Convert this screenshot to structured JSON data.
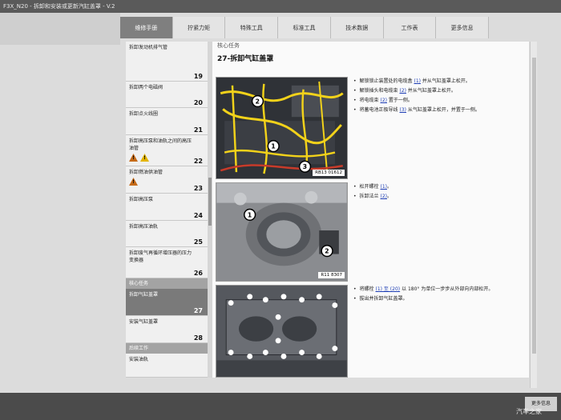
{
  "window": {
    "title": "F3X_N20 - 拆卸和安装或更新汽缸盖罩 - V.2"
  },
  "tabs": [
    {
      "label": "维修手册",
      "active": true
    },
    {
      "label": "拧紧力矩"
    },
    {
      "label": "特殊工具"
    },
    {
      "label": "标准工具"
    },
    {
      "label": "技术数据"
    },
    {
      "label": "工作表"
    },
    {
      "label": "更多信息"
    }
  ],
  "sidebar": {
    "items": [
      {
        "label": "拆卸发动机排气管",
        "num": "19"
      },
      {
        "label": "拆卸两个电磁阀",
        "num": "20"
      },
      {
        "label": "拆卸点火线圈",
        "num": "21"
      },
      {
        "label": "拆卸高压泵和油轨之间的高压油管",
        "num": "22"
      },
      {
        "label": "拆卸燃油供油管",
        "num": "23"
      },
      {
        "label": "拆卸高压泵",
        "num": "24"
      },
      {
        "label": "拆卸高压油轨",
        "num": "25"
      },
      {
        "label": "拆卸废气再循环增压器的压力变换器",
        "num": "26"
      }
    ],
    "core_header": "核心任务",
    "core_items": [
      {
        "label": "拆卸气缸盖罩",
        "num": "27"
      },
      {
        "label": "安装气缸盖罩",
        "num": "28"
      }
    ],
    "followup_header": "后续工作",
    "followup_items": [
      {
        "label": "安装油轨"
      }
    ]
  },
  "content": {
    "cut_heading": "核心任务",
    "title": "27-拆卸气缸盖罩",
    "sections": [
      {
        "image_ref": "RB13 01612",
        "steps": [
          {
            "pre": "解锁锁止装置处的电缆盒",
            "ref": "(1)",
            "post": "并从气缸盖罩上松开。"
          },
          {
            "pre": "解锁插头和电缆束",
            "ref": "(2)",
            "post": "并从气缸盖罩上松开。"
          },
          {
            "pre": "将电缆束",
            "ref": "(2)",
            "post": "置于一侧。"
          },
          {
            "pre": "将蓄电池正极导线",
            "ref": "(3)",
            "post": "从气缸盖罩上松开，并置于一侧。"
          }
        ]
      },
      {
        "image_ref": "R11 8307",
        "steps": [
          {
            "pre": "松开螺栓",
            "ref": "(1)",
            "post": "。"
          },
          {
            "pre": "拆卸法兰",
            "ref": "(2)",
            "post": "。"
          }
        ]
      },
      {
        "image_ref": "",
        "steps": [
          {
            "pre": "将螺栓",
            "ref": "(1) 至 (20)",
            "post": "以 180° 为单位一步步从外部向内部松开。"
          },
          {
            "pre": "拔出并拆卸气缸盖罩。",
            "ref": "",
            "post": ""
          }
        ]
      }
    ]
  },
  "bottom": {
    "button_label": "更多信息"
  },
  "watermark": "汽车之家",
  "colors": {
    "tab_active": "#7f7f7f",
    "link": "#1f3fb5",
    "warning": "#e3b400",
    "wire_yellow": "#f2d21a"
  },
  "icons": [
    "warning-icon",
    "scroll-thumb"
  ]
}
